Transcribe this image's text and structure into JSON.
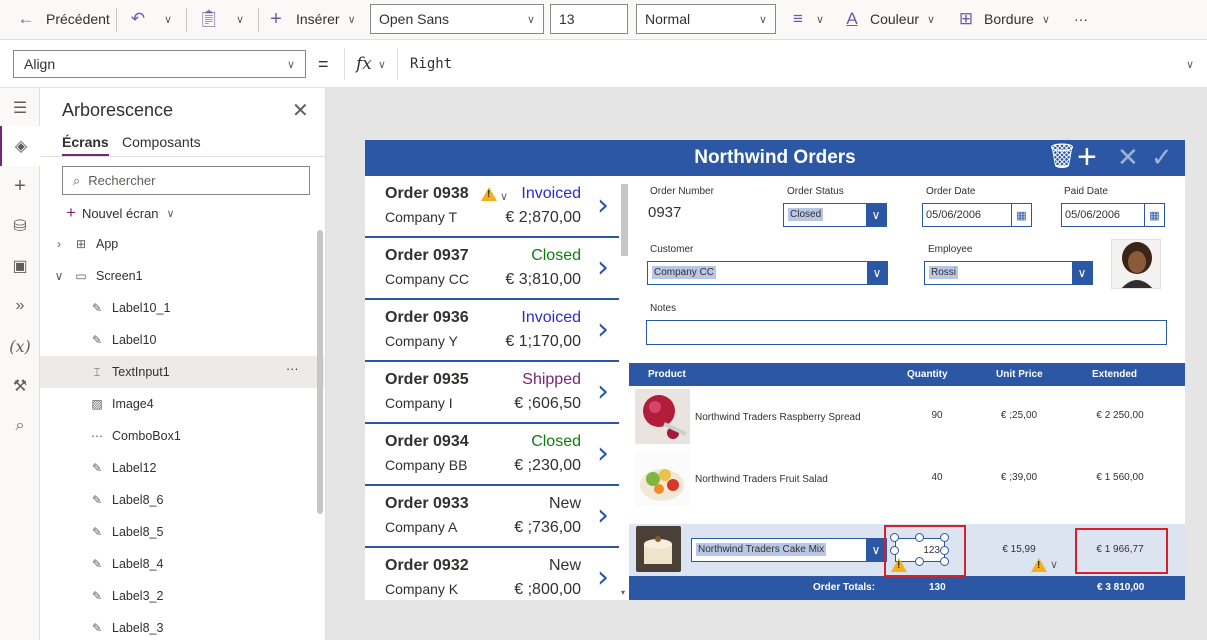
{
  "toolbar": {
    "back_label": "Précédent",
    "insert_label": "Insérer",
    "font_name": "Open Sans",
    "font_size": "13",
    "font_weight": "Normal",
    "color_label": "Couleur",
    "border_label": "Bordure",
    "more_label": "···"
  },
  "formula": {
    "property": "Align",
    "equals": "=",
    "fx": "fx",
    "value": "Right"
  },
  "tree": {
    "title": "Arborescence",
    "tab_screens": "Écrans",
    "tab_components": "Composants",
    "search_placeholder": "Rechercher",
    "new_screen": "Nouvel écran",
    "items": [
      {
        "label": "App",
        "icon": "app-icon"
      },
      {
        "label": "Screen1",
        "icon": "screen-icon"
      },
      {
        "label": "Label10_1",
        "icon": "label-icon"
      },
      {
        "label": "Label10",
        "icon": "label-icon"
      },
      {
        "label": "TextInput1",
        "icon": "textinput-icon"
      },
      {
        "label": "Image4",
        "icon": "image-icon"
      },
      {
        "label": "ComboBox1",
        "icon": "combobox-icon"
      },
      {
        "label": "Label12",
        "icon": "label-icon"
      },
      {
        "label": "Label8_6",
        "icon": "label-icon"
      },
      {
        "label": "Label8_5",
        "icon": "label-icon"
      },
      {
        "label": "Label8_4",
        "icon": "label-icon"
      },
      {
        "label": "Label3_2",
        "icon": "label-icon"
      },
      {
        "label": "Label8_3",
        "icon": "label-icon"
      }
    ],
    "selected_more": "···"
  },
  "app": {
    "title": "Northwind Orders",
    "orders": [
      {
        "name": "Order 0938",
        "status": "Invoiced",
        "status_color": "#2b2bd0",
        "company": "Company T",
        "total": "€ 2;870,00",
        "warning": true
      },
      {
        "name": "Order 0937",
        "status": "Closed",
        "status_color": "#107c10",
        "company": "Company CC",
        "total": "€ 3;810,00",
        "warning": false
      },
      {
        "name": "Order 0936",
        "status": "Invoiced",
        "status_color": "#2b2bd0",
        "company": "Company Y",
        "total": "€ 1;170,00",
        "warning": false
      },
      {
        "name": "Order 0935",
        "status": "Shipped",
        "status_color": "#742774",
        "company": "Company I",
        "total": "€ ;606,50",
        "warning": false
      },
      {
        "name": "Order 0934",
        "status": "Closed",
        "status_color": "#107c10",
        "company": "Company BB",
        "total": "€ ;230,00",
        "warning": false
      },
      {
        "name": "Order 0933",
        "status": "New",
        "status_color": "#323130",
        "company": "Company A",
        "total": "€ ;736,00",
        "warning": false
      },
      {
        "name": "Order 0932",
        "status": "New",
        "status_color": "#323130",
        "company": "Company K",
        "total": "€ ;800,00",
        "warning": false
      }
    ],
    "form": {
      "order_number_label": "Order Number",
      "order_number": "0937",
      "order_status_label": "Order Status",
      "order_status": "Closed",
      "order_date_label": "Order Date",
      "order_date": "05/06/2006",
      "paid_date_label": "Paid Date",
      "paid_date": "05/06/2006",
      "customer_label": "Customer",
      "customer": "Company CC",
      "employee_label": "Employee",
      "employee": "Rossi",
      "notes_label": "Notes",
      "notes": ""
    },
    "lines_header": {
      "product": "Product",
      "quantity": "Quantity",
      "unit_price": "Unit Price",
      "extended": "Extended"
    },
    "lines": [
      {
        "product": "Northwind Traders Raspberry Spread",
        "quantity": "90",
        "unit_price": "€ ;25,00",
        "extended": "€ 2 250,00"
      },
      {
        "product": "Northwind Traders Fruit Salad",
        "quantity": "40",
        "unit_price": "€ ;39,00",
        "extended": "€ 1 560,00"
      },
      {
        "product": "Northwind Traders Cake Mix",
        "quantity": "123",
        "unit_price": "€ 15,99",
        "extended": "€ 1 966,77"
      }
    ],
    "totals": {
      "label": "Order Totals:",
      "quantity": "130",
      "extended": "€ 3 810,00"
    }
  }
}
